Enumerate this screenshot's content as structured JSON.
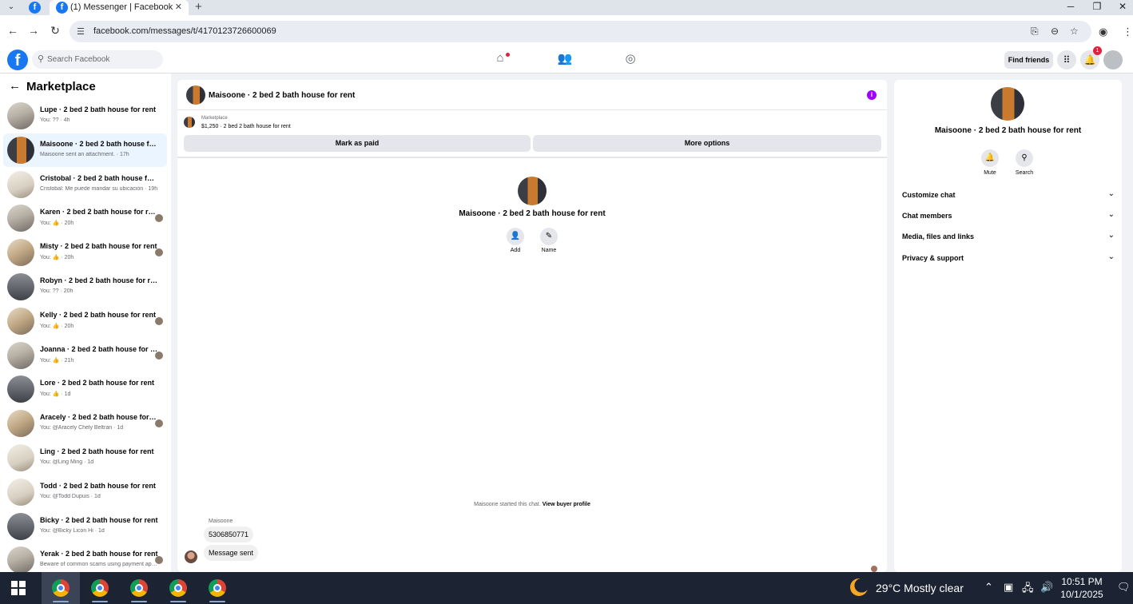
{
  "browser": {
    "tab_title": "(1) Messenger | Facebook",
    "url": "facebook.com/messages/t/4170123726600069",
    "new_tab_icon": "+",
    "close_tab_icon": "✕"
  },
  "fb": {
    "search_placeholder": "Search Facebook",
    "find_friends": "Find friends",
    "notification_count": "1"
  },
  "sidebar": {
    "title": "Marketplace",
    "conversations": [
      {
        "name": "Lupe · 2 bed 2 bath house for rent",
        "sub": "You: ?? · 4h",
        "pic": "pic-room",
        "active": false,
        "read_dot": false
      },
      {
        "name": "Maisoone · 2 bed 2 bath house for rent",
        "sub": "Maisoone sent an attachment. · 17h",
        "pic": "pic-door",
        "active": true,
        "read_dot": false
      },
      {
        "name": "Cristobal · 2 bed 2 bath house for rent",
        "sub": "Cristobal: Me puede mandar su ubicación · 19h",
        "pic": "pic-light",
        "active": false,
        "read_dot": false
      },
      {
        "name": "Karen · 2 bed 2 bath house for rent",
        "sub": "You: 👍 · 20h",
        "pic": "pic-room",
        "active": false,
        "read_dot": true
      },
      {
        "name": "Misty · 2 bed 2 bath house for rent",
        "sub": "You: 👍 · 20h",
        "pic": "pic-kitchen",
        "active": false,
        "read_dot": true
      },
      {
        "name": "Robyn · 2 bed 2 bath house for rent",
        "sub": "You: ?? · 20h",
        "pic": "pic-hall",
        "active": false,
        "read_dot": false
      },
      {
        "name": "Kelly · 2 bed 2 bath house for rent",
        "sub": "You: 👍 · 20h",
        "pic": "pic-kitchen",
        "active": false,
        "read_dot": true
      },
      {
        "name": "Joanna · 2 bed 2 bath house for rent",
        "sub": "You: 👍 · 21h",
        "pic": "pic-room",
        "active": false,
        "read_dot": true
      },
      {
        "name": "Lore · 2 bed 2 bath house for rent",
        "sub": "You: 👍 · 1d",
        "pic": "pic-hall",
        "active": false,
        "read_dot": false
      },
      {
        "name": "Aracely · 2 bed 2 bath house for rent",
        "sub": "You: @Aracely Chely Beltran · 1d",
        "pic": "pic-kitchen",
        "active": false,
        "read_dot": true
      },
      {
        "name": "Ling · 2 bed 2 bath house for rent",
        "sub": "You: @Ling Ming · 1d",
        "pic": "pic-light",
        "active": false,
        "read_dot": false
      },
      {
        "name": "Todd · 2 bed 2 bath house for rent",
        "sub": "You: @Todd Dupuis · 1d",
        "pic": "pic-light",
        "active": false,
        "read_dot": false
      },
      {
        "name": "Bicky · 2 bed 2 bath house for rent",
        "sub": "You: @Bicky Licon Hi · 1d",
        "pic": "pic-hall",
        "active": false,
        "read_dot": false
      },
      {
        "name": "Yerak · 2 bed 2 bath house for rent",
        "sub": "Beware of common scams using payment apps · 1d",
        "pic": "pic-room",
        "active": false,
        "read_dot": true
      }
    ]
  },
  "chat": {
    "title": "Maisoone · 2 bed 2 bath house for rent",
    "marketplace_label": "Marketplace",
    "listing": "$1,250 · 2 bed 2 bath house for rent",
    "mark_as_paid": "Mark as paid",
    "more_options": "More options",
    "hero_name": "Maisoone · 2 bed 2 bath house for rent",
    "add_label": "Add",
    "name_label": "Name",
    "started_text": "Maisoone started this chat.",
    "view_buyer_profile": "View buyer profile",
    "sender": "Maisoone",
    "messages": [
      "5306850771",
      "Message sent"
    ]
  },
  "details": {
    "name": "Maisoone · 2 bed 2 bath house for rent",
    "mute_label": "Mute",
    "search_label": "Search",
    "sections": [
      "Customize chat",
      "Chat members",
      "Media, files and links",
      "Privacy & support"
    ]
  },
  "taskbar": {
    "weather": "29°C  Mostly clear",
    "time": "10:51 PM",
    "date": "10/1/2025"
  }
}
